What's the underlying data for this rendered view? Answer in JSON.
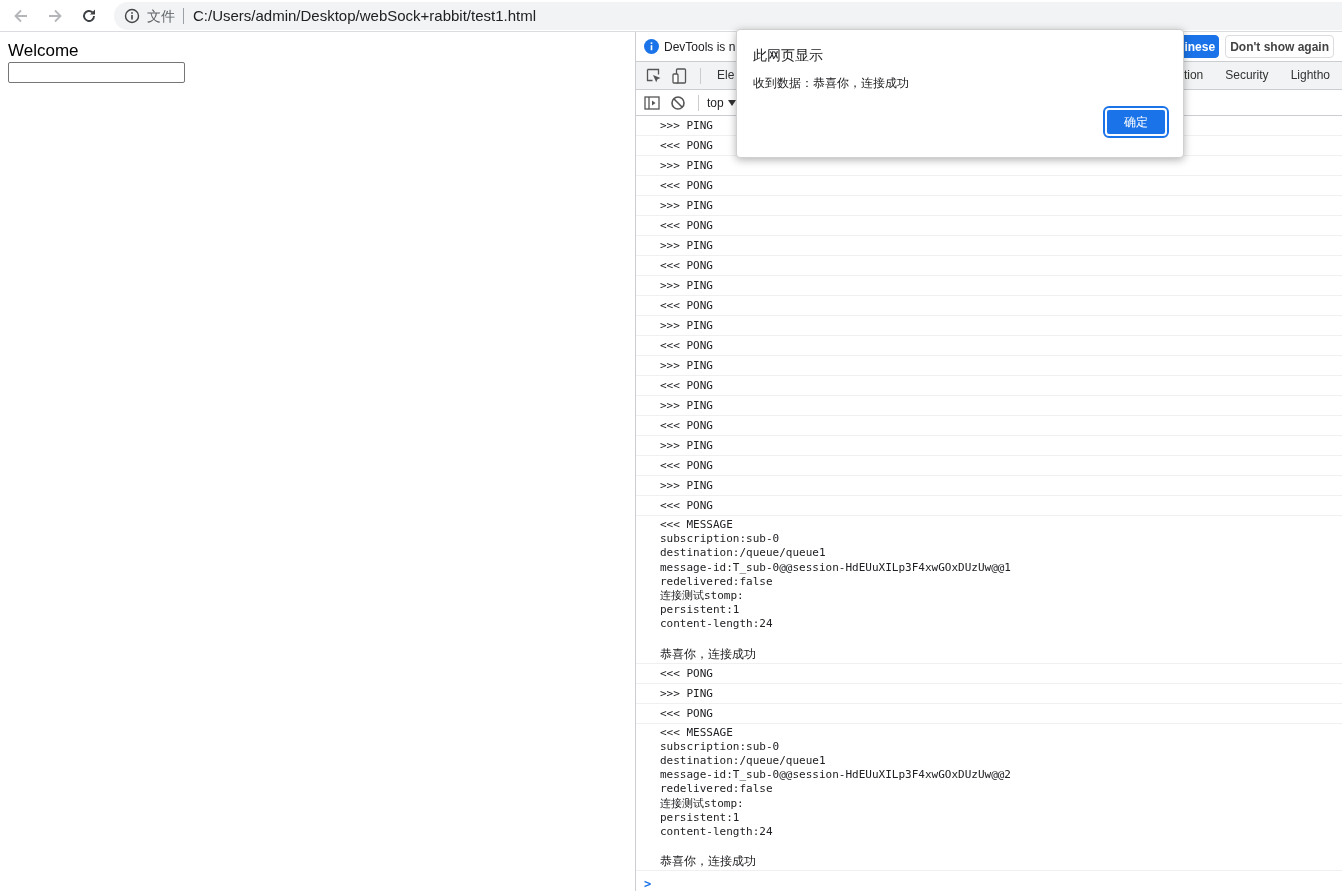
{
  "browser": {
    "nav": [
      {
        "kind": "back",
        "disabled": true
      },
      {
        "kind": "forward",
        "disabled": true
      },
      {
        "kind": "reload",
        "disabled": false
      }
    ],
    "scheme_label": "文件",
    "url": "C:/Users/admin/Desktop/webSock+rabbit/test1.html"
  },
  "page": {
    "heading": "Welcome"
  },
  "devtools": {
    "infobar": {
      "text": "DevTools is n",
      "buttons": [
        {
          "label": "inese",
          "kind": "primary"
        },
        {
          "label": "Don't show again",
          "kind": "secondary"
        }
      ]
    },
    "tabs_left": [
      {
        "label": "Ele",
        "selected": false
      }
    ],
    "tabs_right": [
      {
        "label": "tion",
        "selected": false
      },
      {
        "label": "Security",
        "selected": false
      },
      {
        "label": "Lightho",
        "selected": false
      }
    ],
    "context": "top",
    "log": [
      {
        "kind": "frame",
        "text": ">>> PING"
      },
      {
        "kind": "frame",
        "text": "<<< PONG"
      },
      {
        "kind": "frame",
        "text": ">>> PING"
      },
      {
        "kind": "frame",
        "text": "<<< PONG"
      },
      {
        "kind": "frame",
        "text": ">>> PING"
      },
      {
        "kind": "frame",
        "text": "<<< PONG"
      },
      {
        "kind": "frame",
        "text": ">>> PING"
      },
      {
        "kind": "frame",
        "text": "<<< PONG"
      },
      {
        "kind": "frame",
        "text": ">>> PING"
      },
      {
        "kind": "frame",
        "text": "<<< PONG"
      },
      {
        "kind": "frame",
        "text": ">>> PING"
      },
      {
        "kind": "frame",
        "text": "<<< PONG"
      },
      {
        "kind": "frame",
        "text": ">>> PING"
      },
      {
        "kind": "frame",
        "text": "<<< PONG"
      },
      {
        "kind": "frame",
        "text": ">>> PING"
      },
      {
        "kind": "frame",
        "text": "<<< PONG"
      },
      {
        "kind": "frame",
        "text": ">>> PING"
      },
      {
        "kind": "frame",
        "text": "<<< PONG"
      },
      {
        "kind": "frame",
        "text": ">>> PING"
      },
      {
        "kind": "frame",
        "text": "<<< PONG"
      },
      {
        "kind": "message",
        "title": "<<< MESSAGE",
        "headers": [
          "subscription:sub-0",
          "destination:/queue/queue1",
          "message-id:T_sub-0@@session-HdEUuXILp3F4xwGOxDUzUw@@1",
          "redelivered:false",
          "连接测试stomp:",
          "persistent:1",
          "content-length:24"
        ],
        "body": "恭喜你，连接成功"
      },
      {
        "kind": "frame",
        "text": "<<< PONG"
      },
      {
        "kind": "frame",
        "text": ">>> PING"
      },
      {
        "kind": "frame",
        "text": "<<< PONG"
      },
      {
        "kind": "message",
        "title": "<<< MESSAGE",
        "headers": [
          "subscription:sub-0",
          "destination:/queue/queue1",
          "message-id:T_sub-0@@session-HdEUuXILp3F4xwGOxDUzUw@@2",
          "redelivered:false",
          "连接测试stomp:",
          "persistent:1",
          "content-length:24"
        ],
        "body": "恭喜你，连接成功"
      }
    ],
    "prompt": ">"
  },
  "dialog": {
    "title": "此网页显示",
    "message": "收到数据：恭喜你，连接成功",
    "button": "确定"
  }
}
